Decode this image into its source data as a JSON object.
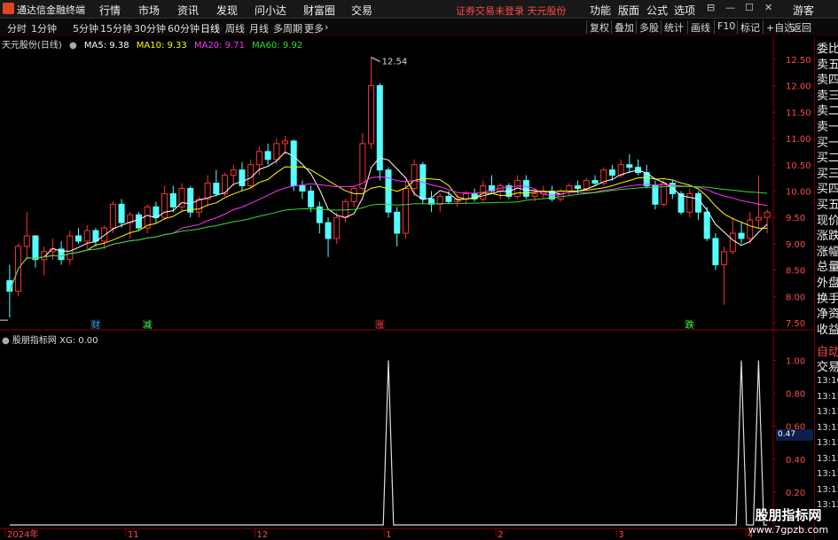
{
  "menubar": {
    "app_title": "通达信金融终端",
    "menus": [
      "行情",
      "市场",
      "资讯",
      "发现",
      "问小达",
      "财富圈",
      "交易"
    ],
    "warning": "证券交易未登录  天元股份",
    "right_menus": [
      "功能",
      "版面",
      "公式",
      "选项"
    ],
    "guest": "游客",
    "window_buttons": [
      "⊟",
      "—",
      "☐",
      "✕"
    ]
  },
  "toolbar": {
    "periods": [
      "分时",
      "1分钟",
      "5分钟",
      "15分钟",
      "30分钟",
      "60分钟",
      "日线",
      "周线",
      "月线",
      "多周期",
      "更多"
    ],
    "active_period": "日线",
    "right_buttons": [
      "复权",
      "叠加",
      "多股",
      "统计",
      "画线",
      "F10",
      "标记",
      "+自选",
      "返回"
    ]
  },
  "main_chart": {
    "stock_label": "天元股份(日线)",
    "ma": [
      {
        "label": "MA5: 9.38",
        "color": "#ffffff"
      },
      {
        "label": "MA10: 9.33",
        "color": "#ffff00"
      },
      {
        "label": "MA20: 9.71",
        "color": "#ff33ff"
      },
      {
        "label": "MA60: 9.92",
        "color": "#33dd33"
      }
    ],
    "high_label": "12.54",
    "low_label": "7.84",
    "events": [
      {
        "text": "财",
        "color": "#3399ff"
      },
      {
        "text": "减",
        "color": "#33ff33"
      },
      {
        "text": "涨",
        "color": "#ff3333"
      },
      {
        "text": "跌",
        "color": "#33ff33"
      }
    ],
    "y_ticks": [
      "12.50",
      "12.00",
      "11.50",
      "11.00",
      "10.50",
      "10.00",
      "9.50",
      "9.00",
      "8.50",
      "8.00",
      "7.50"
    ]
  },
  "indicator": {
    "title": "股朋指标网",
    "value_label": "XG: 0.00",
    "y_ticks": [
      "1.00",
      "0.80",
      "0.60",
      "0.40",
      "0.20"
    ],
    "cursor_value": "0.47"
  },
  "x_axis": {
    "labels": [
      "2024年",
      "11",
      "12",
      "1",
      "2",
      "3",
      "4"
    ]
  },
  "right_panel": {
    "rows": [
      "委比",
      "卖五",
      "卖四",
      "卖三",
      "卖二",
      "卖一",
      "买一",
      "买二",
      "买三",
      "买四",
      "买五",
      "现价",
      "涨跌",
      "涨幅",
      "总量",
      "外盘",
      "换手",
      "净资",
      "收益"
    ],
    "tabs": [
      "自动",
      "交易"
    ],
    "times": [
      "13:10",
      "13:11",
      "13:11",
      "13:11",
      "13:11",
      "13:11",
      "13:11",
      "13:11",
      "13:12"
    ]
  },
  "watermark": {
    "name": "股朋指标网",
    "url": "www.7gpzb.com"
  },
  "chart_data": {
    "type": "candlestick",
    "title": "天元股份(日线)",
    "candles": [
      [
        8.3,
        8.6,
        7.6,
        8.1
      ],
      [
        8.1,
        9.0,
        8.0,
        8.95
      ],
      [
        8.95,
        9.6,
        8.7,
        9.15
      ],
      [
        9.15,
        9.1,
        8.55,
        8.7
      ],
      [
        8.7,
        8.95,
        8.4,
        8.85
      ],
      [
        8.85,
        9.1,
        8.7,
        8.9
      ],
      [
        8.9,
        9.05,
        8.6,
        8.7
      ],
      [
        8.7,
        9.25,
        8.6,
        9.15
      ],
      [
        9.15,
        9.3,
        9.0,
        9.05
      ],
      [
        9.05,
        9.35,
        8.9,
        9.25
      ],
      [
        9.25,
        9.3,
        8.95,
        9.05
      ],
      [
        9.05,
        9.35,
        8.9,
        9.3
      ],
      [
        9.3,
        9.8,
        9.2,
        9.75
      ],
      [
        9.75,
        9.85,
        9.3,
        9.4
      ],
      [
        9.4,
        9.6,
        9.1,
        9.55
      ],
      [
        9.55,
        9.6,
        9.25,
        9.3
      ],
      [
        9.3,
        9.75,
        9.2,
        9.7
      ],
      [
        9.7,
        9.8,
        9.4,
        9.5
      ],
      [
        9.5,
        10.1,
        9.45,
        9.95
      ],
      [
        9.95,
        10.1,
        9.6,
        9.7
      ],
      [
        9.7,
        10.15,
        9.6,
        10.05
      ],
      [
        10.05,
        10.1,
        9.5,
        9.6
      ],
      [
        9.6,
        9.9,
        9.5,
        9.85
      ],
      [
        9.85,
        10.3,
        9.7,
        10.15
      ],
      [
        10.15,
        10.4,
        9.9,
        9.95
      ],
      [
        9.95,
        10.35,
        9.9,
        10.3
      ],
      [
        10.3,
        10.5,
        10.1,
        10.4
      ],
      [
        10.4,
        10.55,
        10.0,
        10.1
      ],
      [
        10.1,
        10.6,
        10.05,
        10.5
      ],
      [
        10.5,
        10.85,
        10.3,
        10.75
      ],
      [
        10.75,
        10.9,
        10.5,
        10.6
      ],
      [
        10.6,
        11.0,
        10.5,
        10.9
      ],
      [
        10.9,
        11.05,
        10.7,
        10.95
      ],
      [
        10.95,
        10.98,
        10.0,
        10.1
      ],
      [
        10.1,
        10.2,
        9.85,
        10.0
      ],
      [
        10.0,
        10.1,
        9.6,
        9.7
      ],
      [
        9.7,
        9.8,
        9.2,
        9.4
      ],
      [
        9.4,
        9.5,
        8.75,
        9.1
      ],
      [
        9.1,
        9.6,
        9.0,
        9.5
      ],
      [
        9.5,
        9.85,
        9.4,
        9.8
      ],
      [
        9.8,
        10.1,
        9.7,
        10.05
      ],
      [
        10.05,
        11.1,
        10.0,
        10.9
      ],
      [
        10.9,
        12.54,
        10.8,
        12.0
      ],
      [
        12.0,
        12.05,
        10.2,
        10.4
      ],
      [
        10.4,
        10.45,
        9.5,
        9.6
      ],
      [
        9.6,
        9.7,
        8.95,
        9.2
      ],
      [
        9.2,
        10.2,
        9.1,
        10.05
      ],
      [
        10.05,
        10.6,
        9.9,
        10.5
      ],
      [
        10.5,
        10.55,
        9.75,
        9.85
      ],
      [
        9.85,
        10.0,
        9.6,
        9.75
      ],
      [
        9.75,
        9.95,
        9.6,
        9.9
      ],
      [
        9.9,
        10.0,
        9.75,
        9.8
      ],
      [
        9.8,
        9.95,
        9.7,
        9.85
      ],
      [
        9.85,
        10.0,
        9.75,
        9.95
      ],
      [
        9.95,
        10.05,
        9.8,
        9.85
      ],
      [
        9.85,
        10.2,
        9.8,
        10.1
      ],
      [
        10.1,
        10.3,
        9.95,
        10.0
      ],
      [
        10.0,
        10.15,
        9.85,
        10.1
      ],
      [
        10.1,
        10.15,
        9.85,
        9.9
      ],
      [
        9.9,
        10.3,
        9.85,
        10.2
      ],
      [
        10.2,
        10.3,
        9.85,
        9.9
      ],
      [
        9.9,
        10.05,
        9.8,
        9.95
      ],
      [
        9.95,
        10.1,
        9.85,
        10.0
      ],
      [
        10.0,
        10.1,
        9.8,
        9.85
      ],
      [
        9.85,
        10.05,
        9.8,
        10.0
      ],
      [
        10.0,
        10.15,
        9.9,
        10.1
      ],
      [
        10.1,
        10.2,
        9.95,
        10.05
      ],
      [
        10.05,
        10.25,
        10.0,
        10.2
      ],
      [
        10.2,
        10.3,
        10.1,
        10.15
      ],
      [
        10.15,
        10.45,
        10.1,
        10.4
      ],
      [
        10.4,
        10.5,
        10.2,
        10.3
      ],
      [
        10.3,
        10.6,
        10.25,
        10.5
      ],
      [
        10.5,
        10.7,
        10.35,
        10.45
      ],
      [
        10.45,
        10.6,
        10.3,
        10.35
      ],
      [
        10.35,
        10.5,
        10.05,
        10.1
      ],
      [
        10.1,
        10.2,
        9.65,
        9.75
      ],
      [
        9.75,
        10.2,
        9.7,
        10.15
      ],
      [
        10.15,
        10.2,
        9.85,
        9.95
      ],
      [
        9.95,
        10.0,
        9.55,
        9.6
      ],
      [
        9.6,
        10.05,
        9.5,
        9.95
      ],
      [
        9.95,
        10.0,
        9.45,
        9.6
      ],
      [
        9.6,
        9.7,
        9.05,
        9.1
      ],
      [
        9.1,
        9.2,
        8.5,
        8.6
      ],
      [
        8.6,
        8.95,
        7.84,
        8.85
      ],
      [
        8.85,
        9.5,
        8.8,
        9.2
      ],
      [
        9.2,
        9.4,
        9.0,
        9.1
      ],
      [
        9.1,
        9.6,
        9.0,
        9.45
      ],
      [
        9.45,
        10.3,
        9.3,
        9.5
      ],
      [
        9.5,
        9.65,
        9.2,
        9.6
      ]
    ],
    "signal_dates_index": [
      44,
      85,
      87,
      89
    ],
    "ylim": [
      7.4,
      12.7
    ],
    "indicator_ylim": [
      0,
      1.1
    ]
  }
}
